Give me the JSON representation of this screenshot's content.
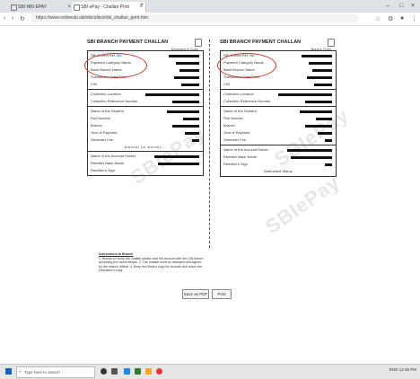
{
  "browser": {
    "tabs": [
      {
        "label": "SBI NRI EPAY"
      },
      {
        "label": "SBI ePay - Challan Print"
      }
    ],
    "url": "https://www.onlinesbi.sbi/sbicollect/sbi_challan_print.htm",
    "nav": {
      "back": "‹",
      "forward": "›",
      "reload": "↻",
      "home": "⌂"
    },
    "window_controls": {
      "min": "–",
      "max": "□",
      "close": "×"
    },
    "new_tab": "+"
  },
  "challan_left": {
    "title": "SBI BRANCH PAYMENT CHALLAN",
    "subtitle": "Depositor's Copy",
    "sections": [
      [
        "SBI Collect Ref. No.",
        "Payment Category Name",
        "Bank Branch Name",
        "Transaction Date/Time",
        "CIN"
      ],
      [
        "Collection Location",
        "Collection Reference Number"
      ],
      [
        "Name of the Student",
        "Roll Number",
        "Branch",
        "Year of Payment",
        "Semester Fee"
      ],
      [
        "Name of the Account Holder",
        "Remitter Bank Name",
        "Remitter's Sign"
      ]
    ],
    "amount_words": "Amount (in words) …"
  },
  "challan_right": {
    "title": "SBI BRANCH PAYMENT CHALLAN",
    "subtitle": "Bank's Copy",
    "sections": [
      [
        "SBI Collect Ref. No.",
        "Payment Category Name",
        "Bank Branch Name",
        "Transaction Date/Time",
        "CIN"
      ],
      [
        "Collection Location",
        "Collection Reference Number"
      ],
      [
        "Name of the Student",
        "Roll Number",
        "Branch",
        "Year of Payment",
        "Semester Fee"
      ],
      [
        "Name of the Account Holder",
        "Remitter Bank Name",
        "Remitter's Sign"
      ]
    ],
    "authorised": "Authorised Stamp"
  },
  "notes": {
    "title": "Instructions to Branch",
    "text": "1. Branch to verify the challan details and the amount with the CIN before accepting the cash/cheque. 2. The challan must be stamped and signed by the branch official. 3. Keep the Bank's copy for records and return the Depositor's copy."
  },
  "buttons": {
    "print_pdf": "Save as PDF",
    "print": "Print"
  },
  "watermark": "SBIePay",
  "taskbar": {
    "search_placeholder": "Type here to search",
    "tray": "ENG 12:45 PM"
  },
  "colors": {
    "highlight_oval": "#c0392b",
    "start": "#1565c0"
  }
}
